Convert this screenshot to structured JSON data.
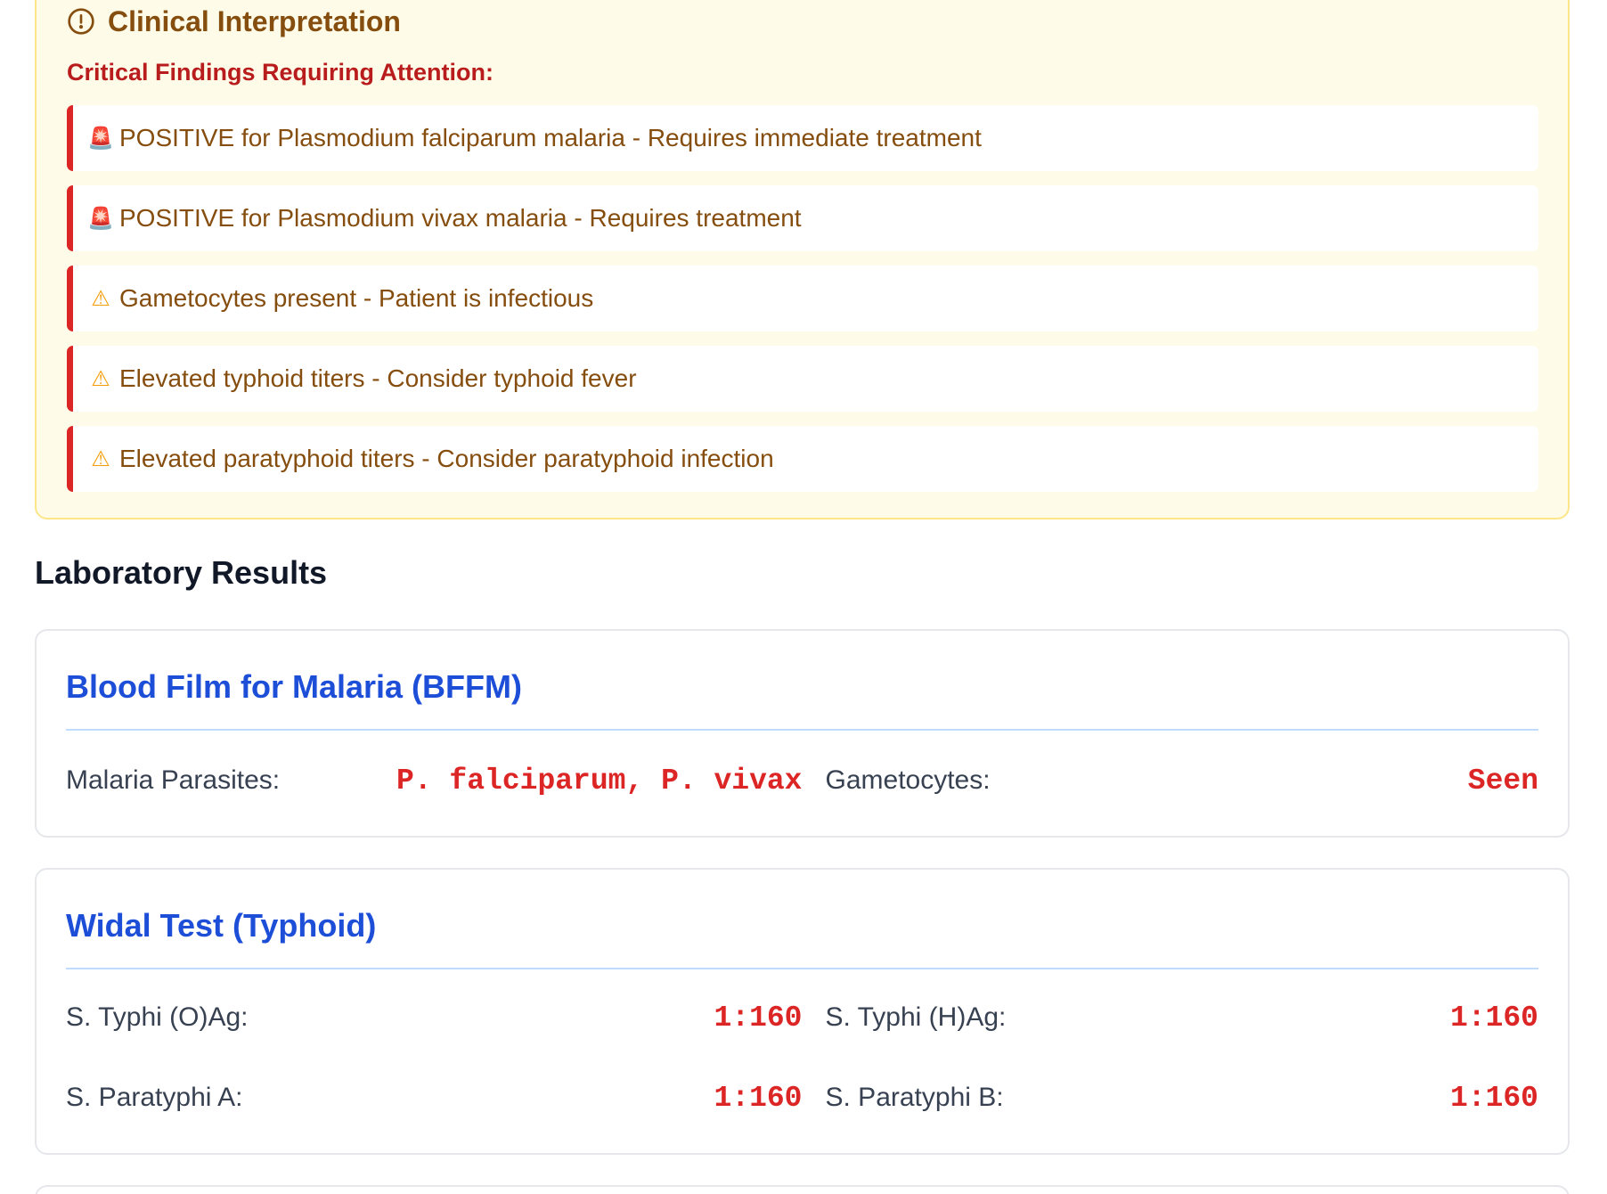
{
  "interpretation": {
    "title": "Clinical Interpretation",
    "icon": "alert-circle-icon",
    "subtitle": "Critical Findings Requiring Attention:",
    "findings": [
      {
        "icon": "siren-icon",
        "text": "POSITIVE for Plasmodium falciparum malaria - Requires immediate treatment"
      },
      {
        "icon": "siren-icon",
        "text": "POSITIVE for Plasmodium vivax malaria - Requires treatment"
      },
      {
        "icon": "warning-icon",
        "text": "Gametocytes present - Patient is infectious"
      },
      {
        "icon": "warning-icon",
        "text": "Elevated typhoid titers - Consider typhoid fever"
      },
      {
        "icon": "warning-icon",
        "text": "Elevated paratyphoid titers - Consider paratyphoid infection"
      }
    ]
  },
  "results": {
    "heading": "Laboratory Results",
    "bffm": {
      "title": "Blood Film for Malaria (BFFM)",
      "items": [
        {
          "label": "Malaria Parasites:",
          "value": "P. falciparum, P. vivax"
        },
        {
          "label": "Gametocytes:",
          "value": "Seen"
        }
      ]
    },
    "widal": {
      "title": "Widal Test (Typhoid)",
      "items": [
        {
          "label": "S. Typhi (O)Ag:",
          "value": "1:160"
        },
        {
          "label": "S. Typhi (H)Ag:",
          "value": "1:160"
        },
        {
          "label": "S. Paratyphi A:",
          "value": "1:160"
        },
        {
          "label": "S. Paratyphi B:",
          "value": "1:160"
        }
      ]
    }
  },
  "colors": {
    "critical_red": "#dc2626",
    "interpretation_bg": "#fefce8",
    "interpretation_text": "#854d0e",
    "card_title_blue": "#1d4ed8"
  }
}
